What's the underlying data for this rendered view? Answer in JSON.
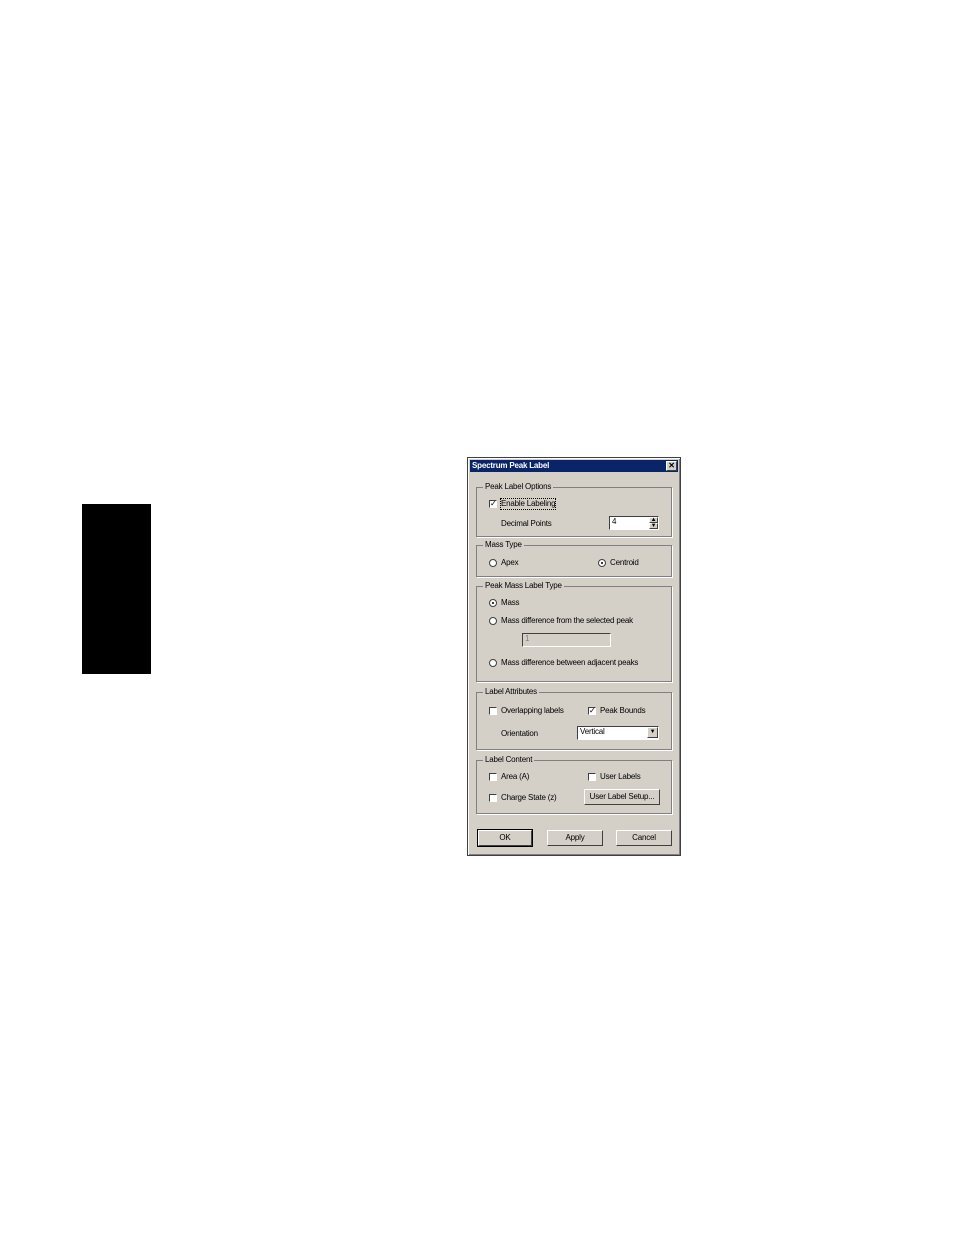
{
  "dialog": {
    "title": "Spectrum Peak Label",
    "close_glyph": "✕"
  },
  "peak_label_options": {
    "legend": "Peak Label Options",
    "enable_labeling": {
      "label": "Enable Labeling",
      "checked": true
    },
    "decimal_points": {
      "label": "Decimal Points",
      "value": "4"
    }
  },
  "mass_type": {
    "legend": "Mass Type",
    "apex": {
      "label": "Apex",
      "selected": false
    },
    "centroid": {
      "label": "Centroid",
      "selected": true
    }
  },
  "peak_mass_label_type": {
    "legend": "Peak Mass Label Type",
    "mass": {
      "label": "Mass",
      "selected": true
    },
    "mass_diff_selected": {
      "label": "Mass difference from the selected peak",
      "selected": false,
      "value": "1"
    },
    "mass_diff_adjacent": {
      "label": "Mass difference between adjacent peaks",
      "selected": false
    }
  },
  "label_attributes": {
    "legend": "Label Attributes",
    "overlapping_labels": {
      "label": "Overlapping labels",
      "checked": false
    },
    "peak_bounds": {
      "label": "Peak Bounds",
      "checked": true
    },
    "orientation": {
      "label": "Orientation",
      "value": "Vertical"
    }
  },
  "label_content": {
    "legend": "Label Content",
    "area": {
      "label": "Area (A)",
      "checked": false
    },
    "user_labels": {
      "label": "User Labels",
      "checked": false
    },
    "charge_state": {
      "label": "Charge State (z)",
      "checked": false
    },
    "user_label_setup": "User Label Setup..."
  },
  "buttons": {
    "ok": "OK",
    "apply": "Apply",
    "cancel": "Cancel"
  },
  "icons": {
    "check_glyph": "✓",
    "spin_up": "▲",
    "spin_down": "▼",
    "dropdown": "▼"
  }
}
